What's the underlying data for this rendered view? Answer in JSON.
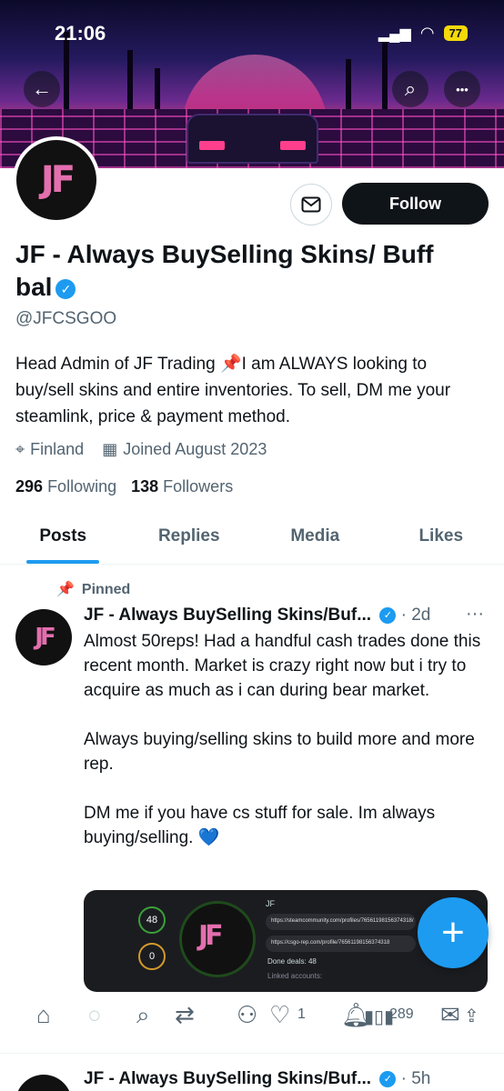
{
  "status_bar": {
    "time": "21:06",
    "battery": "77"
  },
  "header": {
    "back_icon": "←",
    "search_icon": "⌕",
    "more_icon": "•••"
  },
  "avatar_letters": "JF",
  "profile": {
    "follow_label": "Follow",
    "name": "JF - Always BuySelling Skins/ Buff bal",
    "verified_mark": "✓",
    "handle": "@JFCSGOO",
    "bio": "Head Admin of JF Trading 📌I am ALWAYS looking to buy/sell skins and entire inventories. To sell, DM me your steamlink, price & payment method.",
    "location": "Finland",
    "joined": "Joined August 2023",
    "following_count": "296",
    "following_label": "Following",
    "followers_count": "138",
    "followers_label": "Followers"
  },
  "tabs": [
    {
      "label": "Posts"
    },
    {
      "label": "Replies"
    },
    {
      "label": "Media"
    },
    {
      "label": "Likes"
    }
  ],
  "pinned_post": {
    "pinned_label": "Pinned",
    "author": "JF - Always BuySelling Skins/Buf...",
    "time": "2d",
    "text": "Almost 50reps! Had a handful cash trades done this recent month. Market is crazy right now but i try to acquire as much as i can during bear market.\n\nAlways buying/selling skins to build more and more rep.\n\nDM me if you have cs stuff for sale. Im always buying/selling. 💙",
    "media": {
      "title": "JF",
      "rep_up": "48",
      "rep_down": "0",
      "link1": "https://steamcommunity.com/profiles/76561198156374318/",
      "link2": "https://csgo-rep.com/profile/76561198156374318",
      "done_deals": "Done deals:",
      "done_deals_count": "48",
      "linked_accounts": "Linked accounts:"
    },
    "likes": "1",
    "views": "289"
  },
  "next_post": {
    "author": "JF - Always BuySelling Skins/Buf...",
    "time": "5h"
  },
  "colors": {
    "accent": "#1d9bf0",
    "text": "#0f1419",
    "muted": "#536471"
  }
}
